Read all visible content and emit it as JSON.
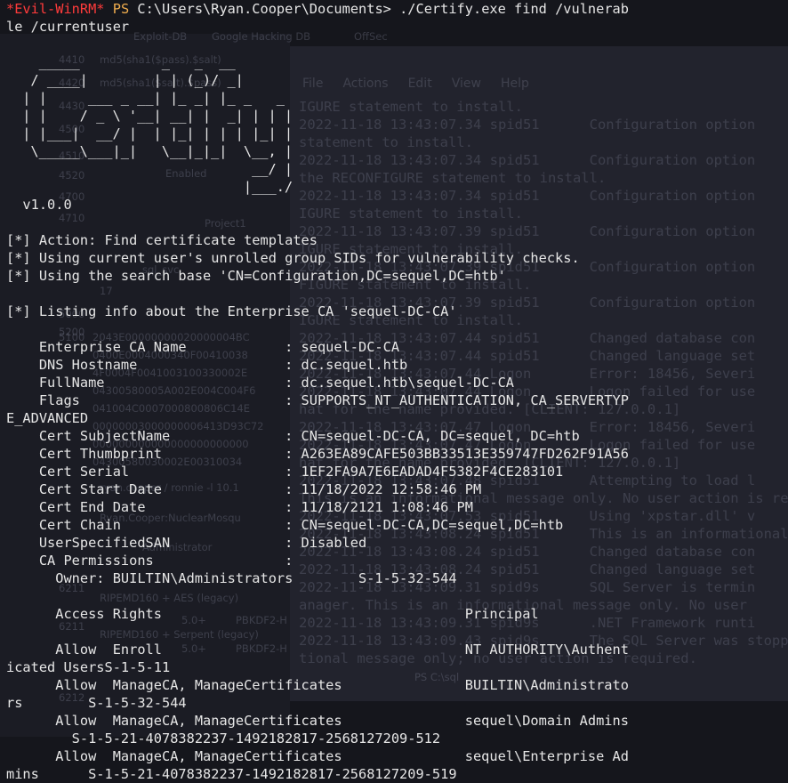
{
  "background_windows": {
    "browser_tabs": [
      "Exploit-DB",
      "Google Hacking DB",
      "OffSec"
    ],
    "hash_samples": [
      "md5(sha1($pass).$salt)",
      "md5(sha1($salt).$pass)"
    ],
    "row_numbers": [
      "4410",
      "4420",
      "4430",
      "4500",
      "4510",
      "4520",
      "4700",
      "4710",
      "5000",
      "5100",
      "5200",
      "6211",
      "6211",
      "6212"
    ],
    "hex_rows": [
      "2043E00000000020000004BC",
      "0400E0004000340F00410038",
      "4F0004F0041003100330002E",
      "04300580005A002E004C004F6",
      "041004C0007000800806C14E",
      "00000003000000006413D93C72",
      "000000000000000000000000",
      "04300580030002E00310034"
    ],
    "menu": [
      "File",
      "Actions",
      "Edit",
      "View",
      "Help"
    ],
    "vpn_labels": [
      "RIPEMD160 + AES (legacy)",
      "5.0+",
      "PBKDF2-H",
      "RIPEMD160 + Serpent (legacy)",
      "5.0+",
      "PBKDF2-H"
    ],
    "misc": [
      "Enabled",
      "sql_svc",
      "17",
      "Ryan.Cooper:NuclearMosqu",
      "ryan.cooper / ronnie -l 10.1",
      "Administrator",
      "Project1",
      "PS C:\\sql"
    ],
    "sql_log": [
      "IGURE statement to install.",
      "2022-11-18 13:43:07.34 spid51      Configuration option",
      "statement to install.",
      "2022-11-18 13:43:07.34 spid51      Configuration option",
      "the RECONFIGURE statement to install.",
      "2022-11-18 13:43:07.34 spid51      Configuration option",
      "IGURE statement to install.",
      "2022-11-18 13:43:07.39 spid51      Configuration option",
      "IGURE statement to install.",
      "2022-11-18 13:43:07.39 spid51      Configuration option",
      "FIGURE statement to install.",
      "2022-11-18 13:43:07.39 spid51      Configuration option",
      "IGURE statement to install.",
      "2022-11-18 13:43:07.44 spid51      Changed database con",
      "2022-11-18 13:43:07.44 spid51      Changed language set",
      "2022-11-18 13:43:07.44 Logon       Error: 18456, Severi",
      "2022-11-18 13:43:07.44 Logon       Logon failed for use",
      "hat for the name provided. [CLIENT: 127.0.0.1]",
      "2022-11-18 13:43:07.47 Logon       Error: 18456, Severi",
      "2022-11-18 13:43:07.47 Logon       Logon failed for use",
      "hat for the name provided. [CLIENT: 127.0.0.1]",
      "2022-11-18 13:43:07.48 spid51      Attempting to load l",
      "This is an informational message only. No user action is required.",
      "2022-11-18 13:43:07.53 spid51      Using 'xpstar.dll' v",
      "2022-11-18 13:43:08.24 spid51      This is an informational mes",
      "2022-11-18 13:43:08.24 spid51      Changed database con",
      "2022-11-18 13:43:08.24 spid51      Changed language set",
      "2022-11-18 13:43:09.31 spid9s      SQL Server is termin",
      "anager. This is an informational message only. No user",
      "2022-11-18 13:43:09.31 spid9s      .NET Framework runti",
      "2022-11-18 13:43:09.43 spid9s      The SQL Server was stoppe",
      "tional message only; no user action is required."
    ]
  },
  "terminal": {
    "prompt_host": "*Evil-WinRM*",
    "prompt_ps": "PS",
    "prompt_path": "C:\\Users\\Ryan.Cooper\\Documents>",
    "command": "./Certify.exe find /vulnerab",
    "command_wrap": "le /currentuser",
    "banner_ascii": "   _____          _   _  __\n  / ____|        | | (_)/ _|\n | |     ___ _ __| |_ _| |_ _   _\n | |    / _ \\ '__| __| |  _| | | |\n | |___|  __/ |  | |_| | | | |_| |\n  \\_____\\___|_|   \\__|_|_|  \\__, |\n                             __/ |\n                            |___./",
    "version": "  v1.0.0",
    "lines": [
      "[*] Action: Find certificate templates",
      "[*] Using current user's unrolled group SIDs for vulnerability checks.",
      "[*] Using the search base 'CN=Configuration,DC=sequel,DC=htb'",
      "",
      "[*] Listing info about the Enterprise CA 'sequel-DC-CA'",
      "",
      "    Enterprise CA Name            : sequel-DC-CA",
      "    DNS Hostname                  : dc.sequel.htb",
      "    FullName                      : dc.sequel.htb\\sequel-DC-CA",
      "    Flags                         : SUPPORTS_NT_AUTHENTICATION, CA_SERVERTYP",
      "E_ADVANCED",
      "    Cert SubjectName              : CN=sequel-DC-CA, DC=sequel, DC=htb",
      "    Cert Thumbprint               : A263EA89CAFE503BB33513E359747FD262F91A56",
      "    Cert Serial                   : 1EF2FA9A7E6EADAD4F5382F4CE283101",
      "    Cert Start Date               : 11/18/2022 12:58:46 PM",
      "    Cert End Date                 : 11/18/2121 1:08:46 PM",
      "    Cert Chain                    : CN=sequel-DC-CA,DC=sequel,DC=htb",
      "    UserSpecifiedSAN              : Disabled",
      "    CA Permissions                :",
      "      Owner: BUILTIN\\Administrators        S-1-5-32-544",
      "",
      "      Access Rights                                     Principal",
      "",
      "      Allow  Enroll                                     NT AUTHORITY\\Authent",
      "icated UsersS-1-5-11",
      "      Allow  ManageCA, ManageCertificates               BUILTIN\\Administrato",
      "rs        S-1-5-32-544",
      "      Allow  ManageCA, ManageCertificates               sequel\\Domain Admins",
      "        S-1-5-21-4078382237-1492182817-2568127209-512",
      "      Allow  ManageCA, ManageCertificates               sequel\\Enterprise Ad",
      "mins      S-1-5-21-4078382237-1492182817-2568127209-519"
    ]
  }
}
